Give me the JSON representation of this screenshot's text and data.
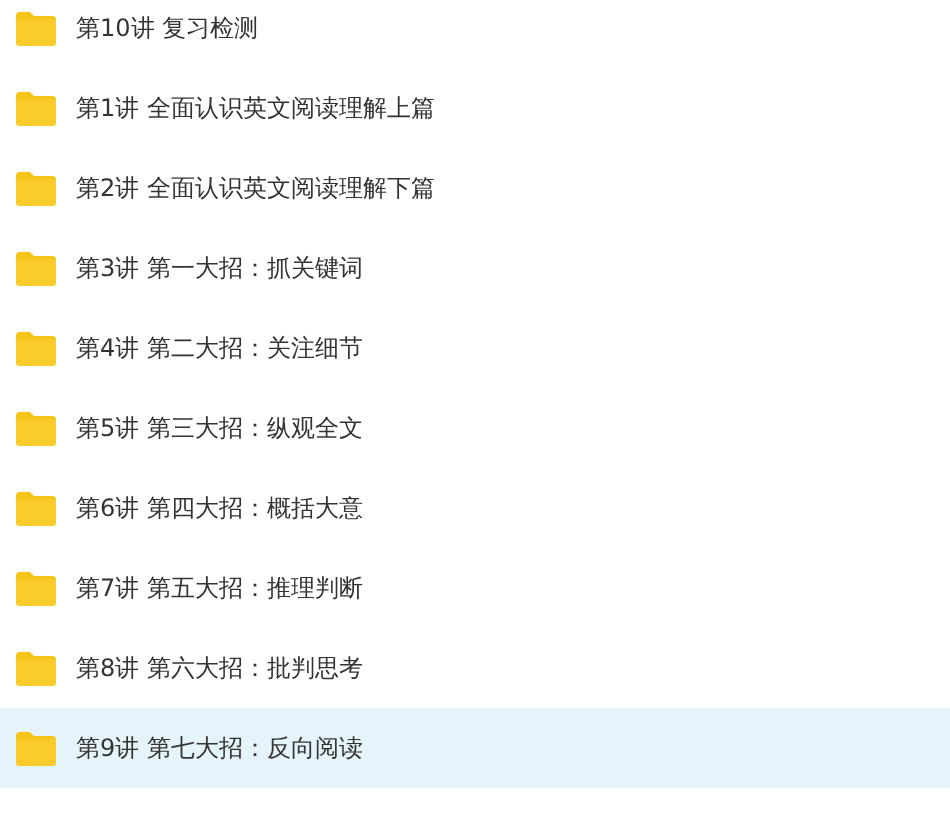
{
  "folders": [
    {
      "name": "第10讲 复习检测",
      "selected": false
    },
    {
      "name": "第1讲 全面认识英文阅读理解上篇",
      "selected": false
    },
    {
      "name": "第2讲 全面认识英文阅读理解下篇",
      "selected": false
    },
    {
      "name": "第3讲 第一大招：抓关键词",
      "selected": false
    },
    {
      "name": "第4讲 第二大招：关注细节",
      "selected": false
    },
    {
      "name": "第5讲 第三大招：纵观全文",
      "selected": false
    },
    {
      "name": "第6讲 第四大招：概括大意",
      "selected": false
    },
    {
      "name": "第7讲 第五大招：推理判断",
      "selected": false
    },
    {
      "name": "第8讲 第六大招：批判思考",
      "selected": false
    },
    {
      "name": "第9讲 第七大招：反向阅读",
      "selected": true
    }
  ]
}
